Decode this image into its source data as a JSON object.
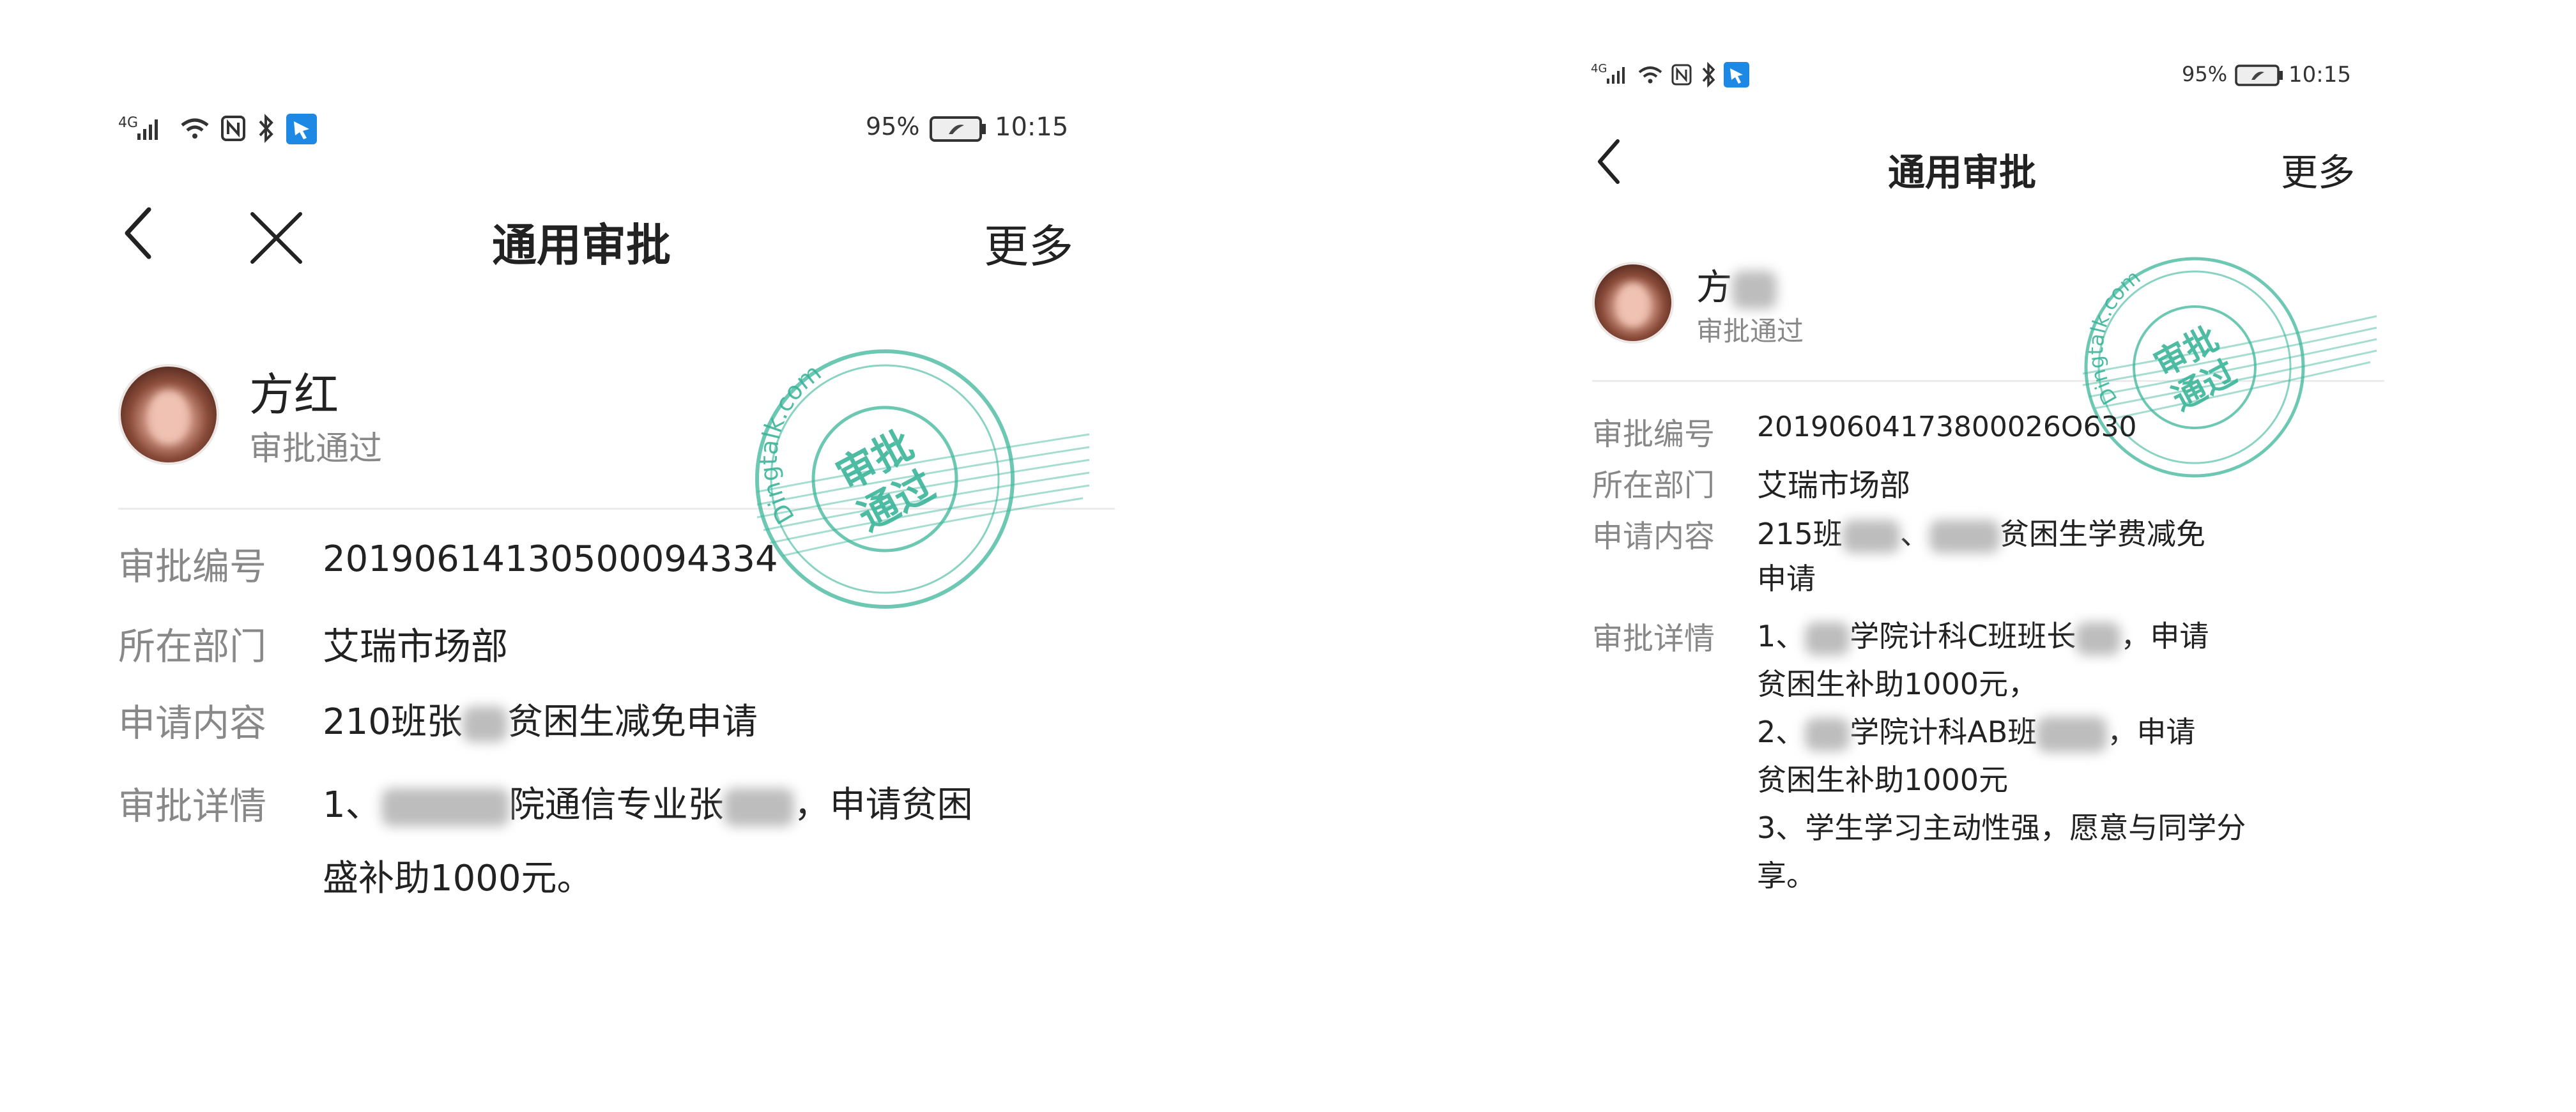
{
  "left": {
    "status": {
      "network": "4G",
      "battery": "95%",
      "time": "10:15"
    },
    "nav": {
      "title": "通用审批",
      "more": "更多"
    },
    "user": {
      "name": "方红",
      "status": "审批通过"
    },
    "stamp": {
      "brand": "Dingtalk.com",
      "line1": "审批",
      "line2": "通过"
    },
    "fields": [
      {
        "label": "审批编号",
        "value": "20190614130500094334"
      },
      {
        "label": "所在部门",
        "value": "艾瑞市场部"
      },
      {
        "label": "申请内容",
        "value_a": "210班张",
        "value_b": "贫困生减免申请"
      },
      {
        "label": "审批详情",
        "l1_a": "1、",
        "l1_b": "院通信专业张",
        "l1_c": "，申请贫困",
        "l2": "盛补助1000元。"
      }
    ]
  },
  "right": {
    "status": {
      "network": "4G",
      "battery": "95%",
      "time": "10:15"
    },
    "nav": {
      "title": "通用审批",
      "more": "更多"
    },
    "user": {
      "name": "方",
      "status": "审批通过"
    },
    "stamp": {
      "brand": "Dingtalk.com",
      "line1": "审批",
      "line2": "通过"
    },
    "fields": [
      {
        "label": "审批编号",
        "value": "20190604173800026O630"
      },
      {
        "label": "所在部门",
        "value": "艾瑞市场部"
      },
      {
        "label": "申请内容",
        "l1_a": "215班",
        "l1_b": "、",
        "l1_c": "贫困生学费减免",
        "l2": "申请"
      },
      {
        "label": "审批详情",
        "l1_a": "1、",
        "l1_b": "学院计科C班班长",
        "l1_c": "，申请",
        "l2": "贫困生补助1000元，",
        "l3_a": "2、",
        "l3_b": "学院计科AB班",
        "l3_c": "，申请",
        "l4": "贫困生补助1000元",
        "l5": "3、学生学习主动性强，愿意与同学分",
        "l6": "享。"
      }
    ]
  },
  "colors": {
    "stamp_green": "#3bb59a",
    "label_gray": "#888888",
    "text": "#222222",
    "bluetooth_badge": "#1e88e5"
  }
}
